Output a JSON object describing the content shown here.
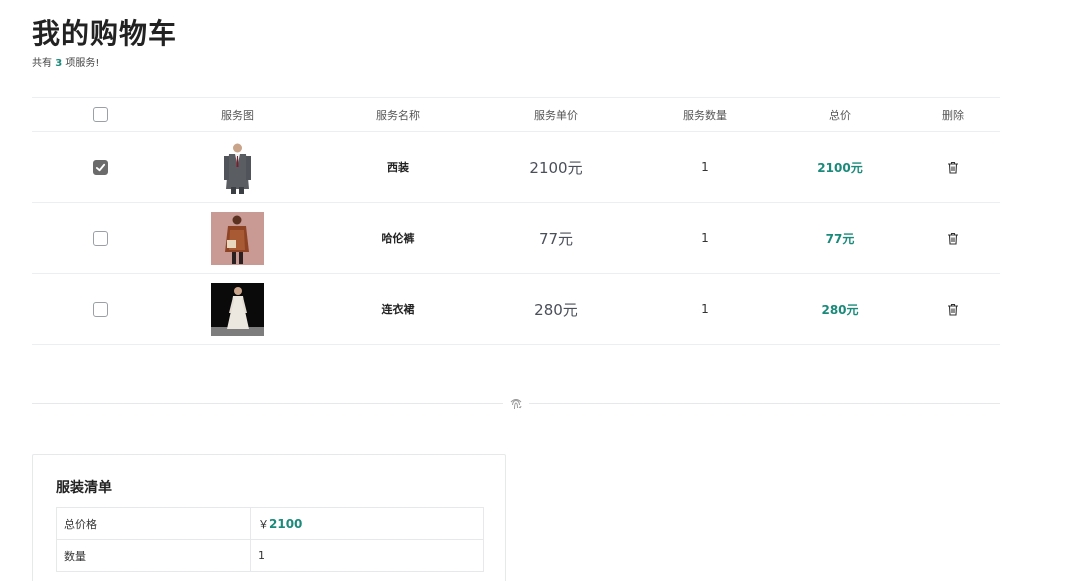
{
  "page": {
    "title": "我的购物车",
    "summary_prefix": "共有",
    "summary_count": "3",
    "summary_suffix": "项服务!"
  },
  "table": {
    "headers": {
      "image": "服务图",
      "name": "服务名称",
      "unit_price": "服务单价",
      "quantity": "服务数量",
      "total": "总价",
      "delete": "删除"
    },
    "select_all_checked": false,
    "rows": [
      {
        "checked": true,
        "name": "西装",
        "price": "2100元",
        "quantity": "1",
        "total": "2100元",
        "image": "grey-suit-photo"
      },
      {
        "checked": false,
        "name": "哈伦裤",
        "price": "77元",
        "quantity": "1",
        "total": "77元",
        "image": "brown-coat-photo"
      },
      {
        "checked": false,
        "name": "连衣裙",
        "price": "280元",
        "quantity": "1",
        "total": "280元",
        "image": "white-dress-photo"
      }
    ]
  },
  "divider_icon": "fingerprint-icon",
  "order": {
    "title": "服装清单",
    "total_label": "总价格",
    "currency": "￥",
    "total_value": "2100",
    "qty_label": "数量",
    "qty_value": "1"
  },
  "colors": {
    "accent": "#1a8a7a",
    "border": "#eceff1"
  }
}
